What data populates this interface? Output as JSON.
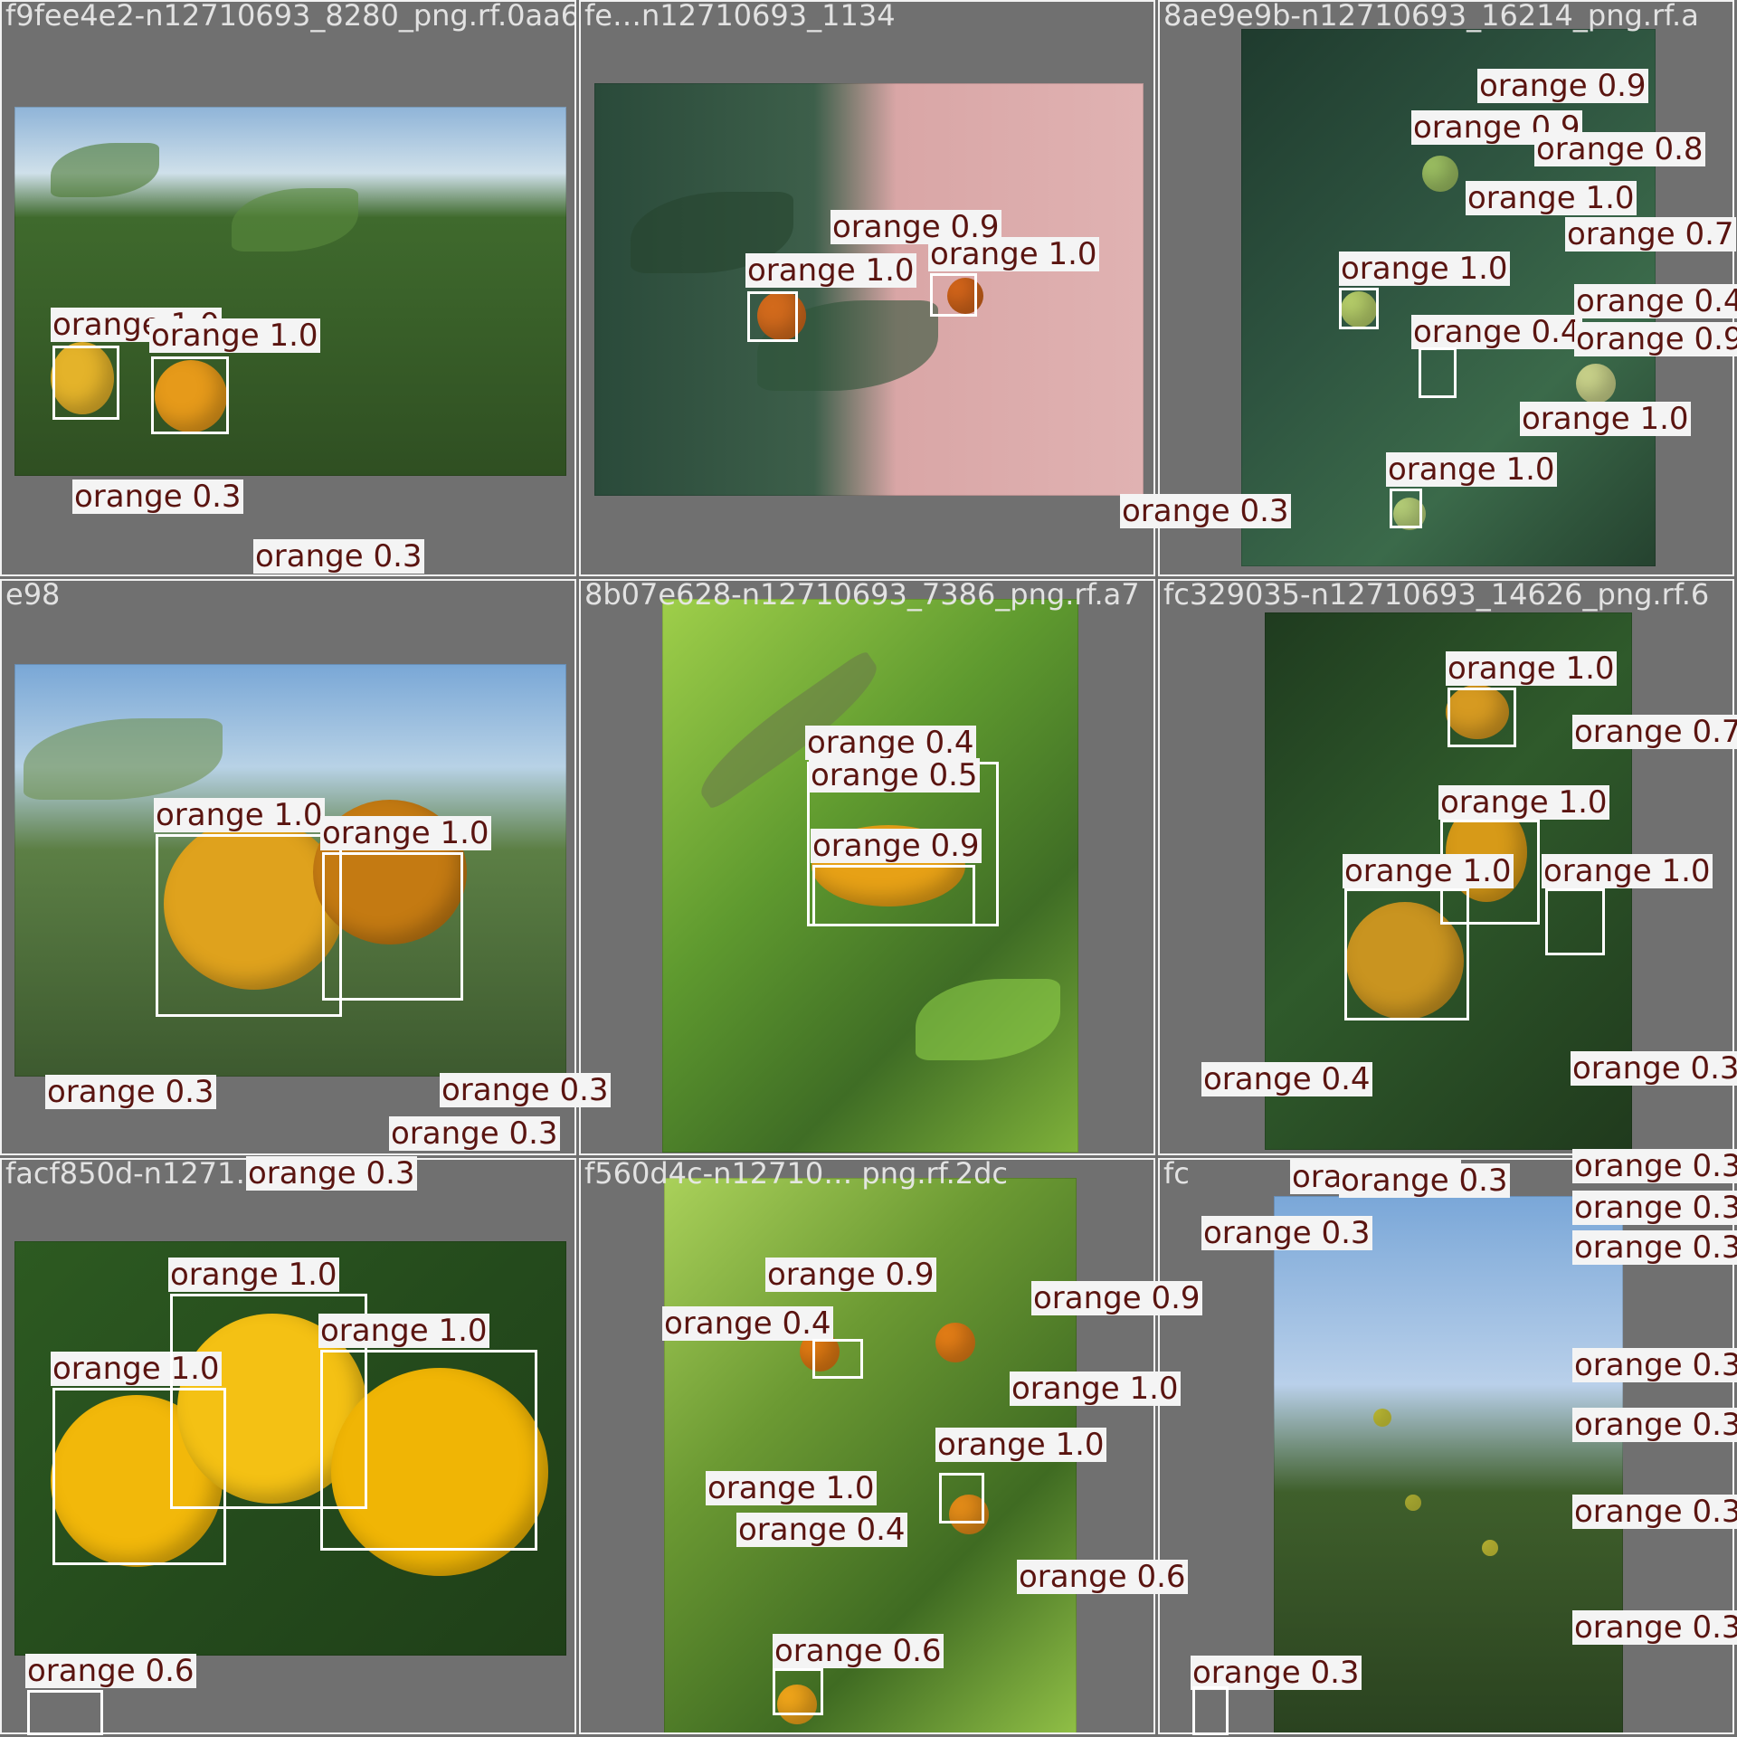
{
  "tiles": [
    {
      "title": "f9fee4e2-n12710693_8280_png.rf.0aa6"
    },
    {
      "title": "fe…n12710693_1134"
    },
    {
      "title": "8ae9e9b-n12710693_16214_png.rf.a"
    },
    {
      "title": "e98"
    },
    {
      "title": "8b07e628-n12710693_7386_png.rf.a7"
    },
    {
      "title": "fc329035-n12710693_14626_png.rf.6"
    },
    {
      "title": "facf850d-n1271… _png.rf.81"
    },
    {
      "title": "f560d4c-n12710… png.rf.2dc"
    },
    {
      "title": "fc"
    }
  ],
  "labels": {
    "o10": "orange 1.0",
    "o09": "orange 0.9",
    "o08": "orange 0.8",
    "o07": "orange 0.7",
    "o06": "orange 0.6",
    "o05": "orange 0.5",
    "o04": "orange 0.4",
    "o03": "orange 0.3"
  },
  "colors": {
    "label_text": "#5a1410",
    "label_bg": "#f4f4f4",
    "box": "#ffffff",
    "tile_border": "#f2f2f2",
    "background": "#707070"
  }
}
